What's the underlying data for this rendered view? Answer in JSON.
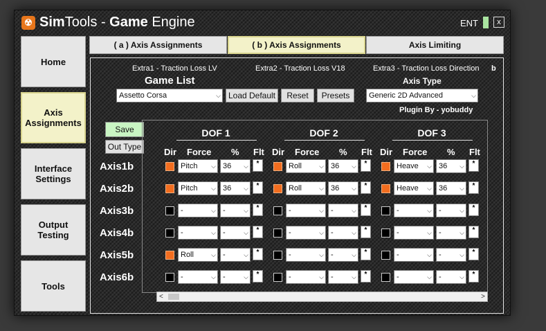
{
  "titlebar": {
    "brand_a": "Sim",
    "brand_b": "Tools",
    "sep": " - ",
    "engine_a": "Game",
    "engine_b": " Engine",
    "license": "ENT",
    "close": "x"
  },
  "nav": [
    {
      "label": "Home",
      "active": false
    },
    {
      "label": "Axis\nAssignments",
      "active": true
    },
    {
      "label": "Interface\nSettings",
      "active": false
    },
    {
      "label": "Output\nTesting",
      "active": false
    },
    {
      "label": "Tools",
      "active": false
    }
  ],
  "tabs": [
    "( a ) Axis Assignments",
    "( b ) Axis Assignments",
    "Axis Limiting"
  ],
  "extras": [
    "Extra1 - Traction Loss LV",
    "Extra2 - Traction Loss V18",
    "Extra3 - Traction Loss Direction",
    "b"
  ],
  "game_list": {
    "label": "Game List",
    "selected": "Assetto Corsa"
  },
  "buttons": {
    "load_default": "Load Default",
    "reset": "Reset",
    "presets": "Presets",
    "save": "Save",
    "out_type": "Out Type"
  },
  "axis_type": {
    "label": "Axis Type",
    "selected": "Generic 2D Advanced"
  },
  "plugin_by": "Plugin By - yobuddy",
  "dof_titles": [
    "DOF 1",
    "DOF 2",
    "DOF 3"
  ],
  "col_headers": {
    "dir": "Dir",
    "force": "Force",
    "pct": "%",
    "flt": "Flt"
  },
  "rows": [
    {
      "axis": "Axis1b",
      "dofs": [
        {
          "dir": true,
          "force": "Pitch",
          "pct": "36",
          "flt": "*"
        },
        {
          "dir": true,
          "force": "Roll",
          "pct": "36",
          "flt": "*"
        },
        {
          "dir": true,
          "force": "Heave",
          "pct": "36",
          "flt": "*"
        }
      ]
    },
    {
      "axis": "Axis2b",
      "dofs": [
        {
          "dir": true,
          "force": "Pitch",
          "pct": "36",
          "flt": "*"
        },
        {
          "dir": true,
          "force": "Roll",
          "pct": "36",
          "flt": "*"
        },
        {
          "dir": true,
          "force": "Heave",
          "pct": "36",
          "flt": "*"
        }
      ]
    },
    {
      "axis": "Axis3b",
      "dofs": [
        {
          "dir": false,
          "force": "-",
          "pct": "-",
          "flt": "*"
        },
        {
          "dir": false,
          "force": "-",
          "pct": "-",
          "flt": "*"
        },
        {
          "dir": false,
          "force": "-",
          "pct": "-",
          "flt": "*"
        }
      ]
    },
    {
      "axis": "Axis4b",
      "dofs": [
        {
          "dir": false,
          "force": "-",
          "pct": "-",
          "flt": "*"
        },
        {
          "dir": false,
          "force": "-",
          "pct": "-",
          "flt": "*"
        },
        {
          "dir": false,
          "force": "-",
          "pct": "-",
          "flt": "*"
        }
      ]
    },
    {
      "axis": "Axis5b",
      "dofs": [
        {
          "dir": true,
          "force": "Roll",
          "pct": "-",
          "flt": "*"
        },
        {
          "dir": false,
          "force": "-",
          "pct": "-",
          "flt": "*"
        },
        {
          "dir": false,
          "force": "-",
          "pct": "-",
          "flt": "*"
        }
      ]
    },
    {
      "axis": "Axis6b",
      "dofs": [
        {
          "dir": false,
          "force": "-",
          "pct": "-",
          "flt": "*"
        },
        {
          "dir": false,
          "force": "-",
          "pct": "-",
          "flt": "*"
        },
        {
          "dir": false,
          "force": "-",
          "pct": "-",
          "flt": "*"
        }
      ]
    }
  ],
  "colors": {
    "accent": "#f26d1f",
    "active_tab": "#f3f2c9",
    "save_green": "#c9f5c3"
  }
}
